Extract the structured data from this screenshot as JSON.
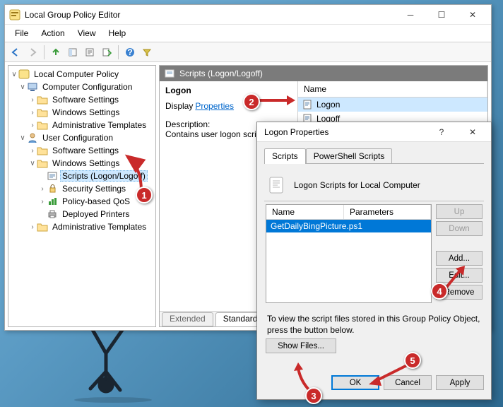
{
  "window": {
    "title": "Local Group Policy Editor",
    "menu": {
      "file": "File",
      "action": "Action",
      "view": "View",
      "help": "Help"
    }
  },
  "tree": {
    "root": "Local Computer Policy",
    "cc": "Computer Configuration",
    "cc_sw": "Software Settings",
    "cc_ws": "Windows Settings",
    "cc_at": "Administrative Templates",
    "uc": "User Configuration",
    "uc_sw": "Software Settings",
    "uc_ws": "Windows Settings",
    "uc_ws_scripts": "Scripts (Logon/Logoff)",
    "uc_ws_sec": "Security Settings",
    "uc_ws_qos": "Policy-based QoS",
    "uc_ws_dp": "Deployed Printers",
    "uc_at": "Administrative Templates"
  },
  "detail": {
    "header": "Scripts (Logon/Logoff)",
    "logon_bold": "Logon",
    "display_label": "Display",
    "properties_link": "Properties ",
    "desc_head": "Description:",
    "desc_body": "Contains user logon scripts.",
    "col_name": "Name",
    "item_logon": "Logon",
    "item_logoff": "Logoff",
    "tab_extended": "Extended",
    "tab_standard": "Standard"
  },
  "dialog": {
    "title": "Logon Properties",
    "tab_scripts": "Scripts",
    "tab_ps": "PowerShell Scripts",
    "heading": "Logon Scripts for Local Computer",
    "col_name": "Name",
    "col_params": "Parameters",
    "row_script": "GetDailyBingPicture.ps1",
    "btn_up": "Up",
    "btn_down": "Down",
    "btn_add": "Add...",
    "btn_edit": "Edit...",
    "btn_remove": "Remove",
    "hint": "To view the script files stored in this Group Policy Object, press the button below.",
    "btn_showfiles": "Show Files...",
    "btn_ok": "OK",
    "btn_cancel": "Cancel",
    "btn_apply": "Apply"
  },
  "callouts": {
    "c1": "1",
    "c2": "2",
    "c3": "3",
    "c4": "4",
    "c5": "5"
  }
}
